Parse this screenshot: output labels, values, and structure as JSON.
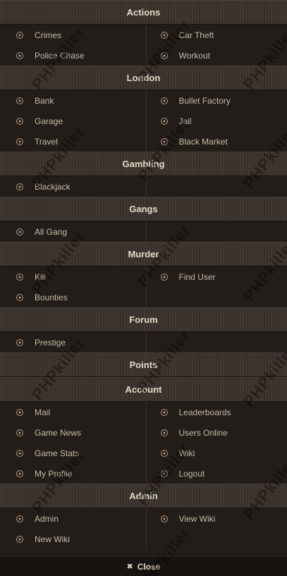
{
  "watermark": "PHPkiller",
  "sections": [
    {
      "title": "Actions",
      "rows": [
        [
          "Crimes",
          "Car Theft"
        ],
        [
          "Police Chase",
          "Workout"
        ]
      ]
    },
    {
      "title": "London",
      "rows": [
        [
          "Bank",
          "Bullet Factory"
        ],
        [
          "Garage",
          "Jail"
        ],
        [
          "Travel",
          "Black Market"
        ]
      ]
    },
    {
      "title": "Gambling",
      "rows": [
        [
          "Blackjack",
          ""
        ]
      ]
    },
    {
      "title": "Gangs",
      "rows": [
        [
          "All Gang",
          ""
        ]
      ]
    },
    {
      "title": "Murder",
      "rows": [
        [
          "Kill",
          "Find User"
        ],
        [
          "Bounties",
          ""
        ]
      ]
    },
    {
      "title": "Forum",
      "rows": [
        [
          "Prestige",
          ""
        ]
      ]
    },
    {
      "title": "Points",
      "rows": []
    },
    {
      "title": "Account",
      "rows": [
        [
          "Mail",
          "Leaderboards"
        ],
        [
          "Game News",
          "Users Online"
        ],
        [
          "Game Stats",
          "Wiki"
        ],
        [
          "My Profile",
          "Logout"
        ]
      ]
    },
    {
      "title": "Admin",
      "rows": [
        [
          "Admin",
          "View Wiki"
        ],
        [
          "New Wiki",
          ""
        ]
      ]
    }
  ],
  "close": {
    "icon": "close-icon",
    "label": "Close"
  },
  "colors": {
    "background": "#221d19",
    "header": "#3a322b",
    "text": "#c9b9a6",
    "bullet": "#b89a80"
  }
}
